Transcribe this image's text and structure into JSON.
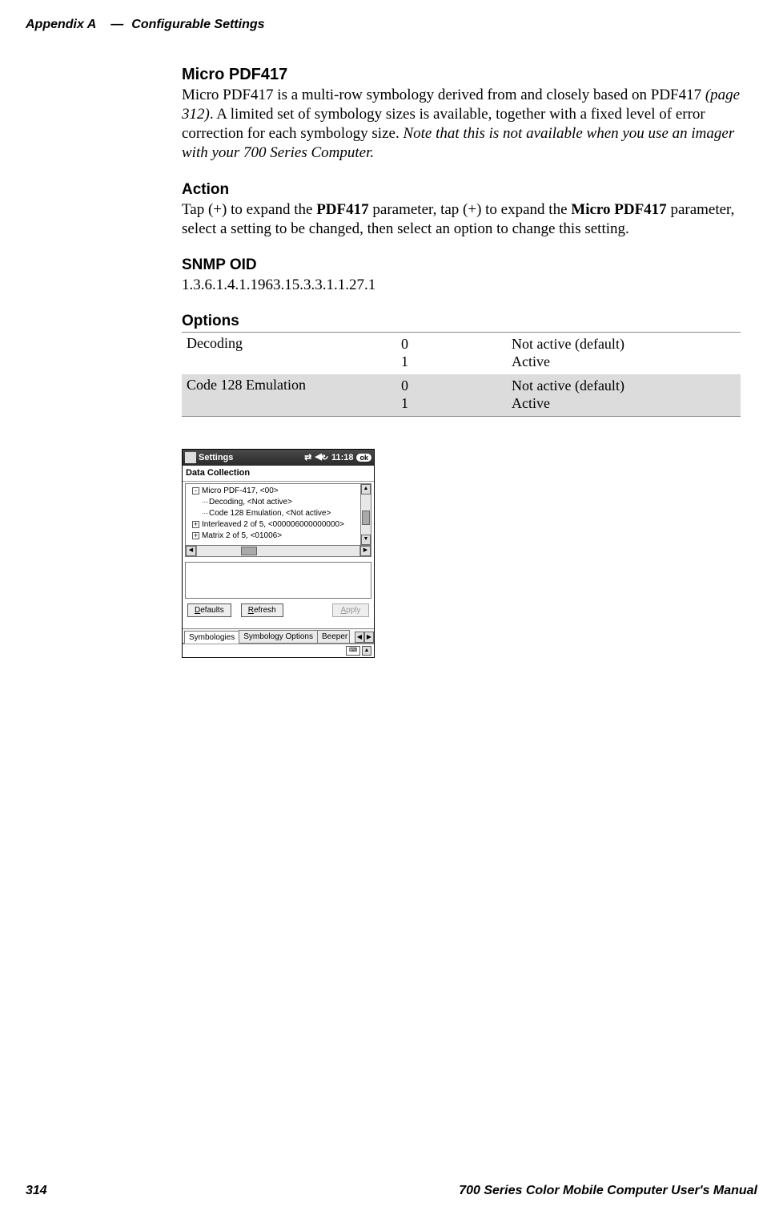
{
  "header": {
    "appendix": "Appendix  A",
    "separator": "—",
    "title": "Configurable Settings"
  },
  "section": {
    "title": "Micro PDF417",
    "intro_1": "Micro PDF417 is a multi-row symbology derived from and closely based on PDF417 ",
    "page_ref": "(page 312)",
    "intro_2": ". A limited set of symbology sizes is available, together with a fixed level of error correction for each symbology size. ",
    "note": "Note that this is not available when you use an imager with your 700 Series Computer.",
    "action_heading": "Action",
    "action_1": "Tap (+) to expand the ",
    "action_bold_1": "PDF417",
    "action_2": " parameter, tap (+) to expand the ",
    "action_bold_2": "Micro PDF417",
    "action_3": " parameter, select a setting to be changed, then select an option to change this setting.",
    "snmp_heading": "SNMP OID",
    "snmp_value": "1.3.6.1.4.1.1963.15.3.3.1.1.27.1",
    "options_heading": "Options",
    "options": [
      {
        "name": "Decoding",
        "codes": [
          "0",
          "1"
        ],
        "values": [
          "Not active (default)",
          "Active"
        ]
      },
      {
        "name": "Code 128 Emulation",
        "codes": [
          "0",
          "1"
        ],
        "values": [
          "Not active (default)",
          "Active"
        ]
      }
    ]
  },
  "device": {
    "title": "Settings",
    "time": "11:18",
    "ok": "ok",
    "section_title": "Data Collection",
    "tree": {
      "node1": "Micro PDF-417, <00>",
      "node1a": "Decoding, <Not active>",
      "node1b": "Code 128 Emulation, <Not active>",
      "node2": "Interleaved 2 of 5, <000006000000000>",
      "node3": "Matrix 2 of 5, <01006>"
    },
    "buttons": {
      "defaults_u": "D",
      "defaults_rest": "efaults",
      "refresh_u": "R",
      "refresh_rest": "efresh",
      "apply_u": "A",
      "apply_rest": "pply"
    },
    "tabs": {
      "t1": "Symbologies",
      "t2": "Symbology Options",
      "t3": "Beeper"
    }
  },
  "footer": {
    "page": "314",
    "manual": "700 Series Color Mobile Computer User's Manual"
  }
}
